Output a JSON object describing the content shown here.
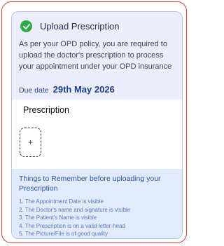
{
  "header": {
    "title": "Upload Prescription",
    "description": "As per your OPD policy, you are required to upload the doctor's prescription to process your appointment under your OPD insurance",
    "due_label": "Due date",
    "due_value": "29th May 2026"
  },
  "prescription": {
    "title": "Prescription",
    "upload_symbol": "+"
  },
  "tips": {
    "title": "Things to Remember before uploading your Prescription",
    "items": [
      "1. The Appointment Date is visible",
      "2. The Doctor's name and signature is visible",
      "3. The Patient's Name is visible",
      "4. The Prescription is on a valid letter-head",
      "5. The Picture/File is of good quality"
    ]
  },
  "icons": {
    "status_icon": "check-circle-icon",
    "upload_icon": "plus-icon"
  },
  "colors": {
    "accent": "#1d3f8f",
    "success": "#2eaa49",
    "outline": "#d23b3b",
    "tips_bg": "#e1ebfb",
    "header_bg": "#eceefb"
  }
}
